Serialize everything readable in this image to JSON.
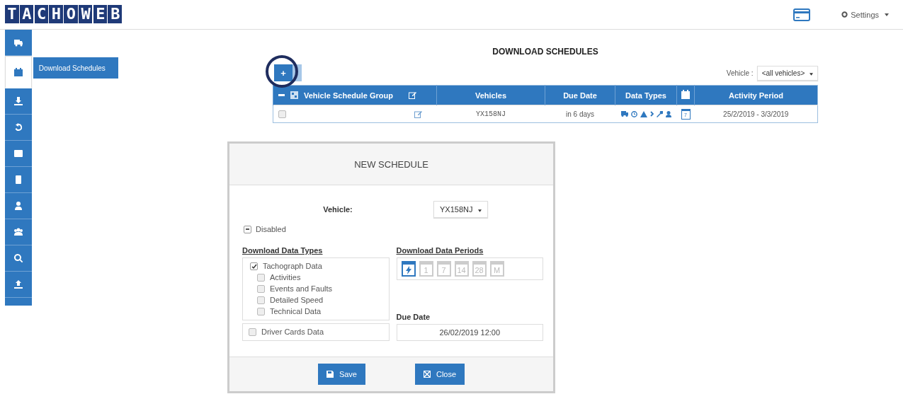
{
  "logo": "TACHOWEB",
  "header": {
    "settings": "Settings"
  },
  "sidebar": {
    "items": [
      {
        "selected": false
      },
      {
        "selected": true
      },
      {
        "selected": false
      },
      {
        "selected": false
      },
      {
        "selected": false
      },
      {
        "selected": false
      },
      {
        "selected": false
      },
      {
        "selected": false
      },
      {
        "selected": false
      },
      {
        "selected": false
      }
    ],
    "flyout": "Download Schedules"
  },
  "page": {
    "title": "DOWNLOAD SCHEDULES",
    "add_button": "+",
    "filter_label": "Vehicle :",
    "filter_value": "<all vehicles>"
  },
  "table": {
    "columns": [
      "Vehicle Schedule Group",
      "Vehicles",
      "Due Date",
      "Data Types",
      "Activity Period"
    ],
    "all_checked": false,
    "rows": [
      {
        "checked": false,
        "vehicles": "YX158NJ",
        "due": "in 6 days",
        "period_day": "7",
        "activity_period": "25/2/2019 - 3/3/2019"
      }
    ]
  },
  "modal": {
    "title": "NEW SCHEDULE",
    "vehicle_label": "Vehicle:",
    "vehicle_value": "YX158NJ",
    "disabled_label": "Disabled",
    "disabled_checked": false,
    "types_heading": "Download Data Types",
    "periods_heading": "Download Data Periods",
    "tacho": {
      "label": "Tachograph Data",
      "checked": true
    },
    "subtypes": [
      {
        "label": "Activities",
        "checked": false
      },
      {
        "label": "Events and Faults",
        "checked": false
      },
      {
        "label": "Detailed Speed",
        "checked": false
      },
      {
        "label": "Technical Data",
        "checked": false
      }
    ],
    "driver": {
      "label": "Driver Cards Data",
      "checked": false
    },
    "periods": [
      {
        "kind": "now",
        "selected": true
      },
      {
        "kind": "days",
        "label": "1",
        "selected": false
      },
      {
        "kind": "days",
        "label": "7",
        "selected": false
      },
      {
        "kind": "days",
        "label": "14",
        "selected": false
      },
      {
        "kind": "days",
        "label": "28",
        "selected": false
      },
      {
        "kind": "days",
        "label": "M",
        "selected": false
      }
    ],
    "due_label": "Due Date",
    "due_value": "26/02/2019 12:00",
    "buttons": [
      "Save",
      "Close"
    ]
  }
}
